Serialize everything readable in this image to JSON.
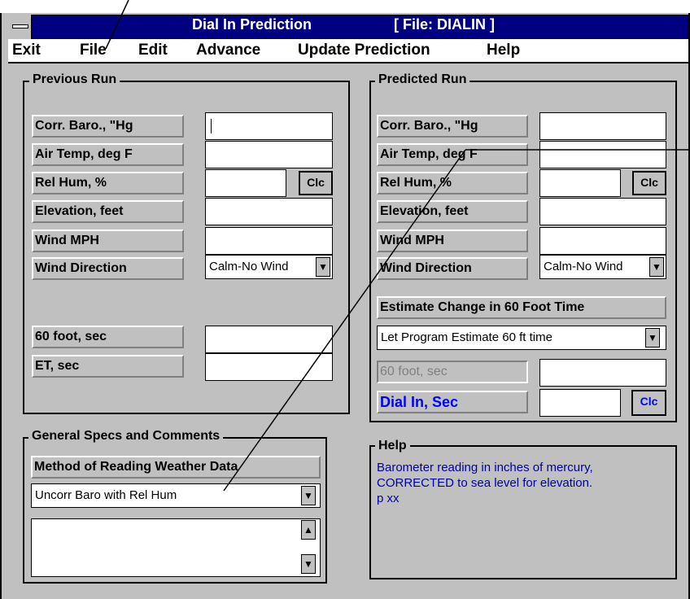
{
  "window": {
    "title": "Dial In Prediction",
    "file_label": "[ File: DIALIN ]"
  },
  "menu": [
    "Exit",
    "File",
    "Edit",
    "Advance",
    "Update Prediction",
    "Help"
  ],
  "previous_run": {
    "title": "Previous Run",
    "labels": [
      "Corr. Baro., \"Hg",
      "Air Temp, deg F",
      "Rel Hum, %",
      "Elevation, feet",
      "Wind MPH",
      "Wind Direction"
    ],
    "clc": "Clc",
    "wind_direction": "Calm-No Wind",
    "sixty_foot": "60 foot, sec",
    "et": "ET, sec"
  },
  "predicted_run": {
    "title": "Predicted Run",
    "labels": [
      "Corr. Baro., \"Hg",
      "Air Temp, deg F",
      "Rel Hum, %",
      "Elevation, feet",
      "Wind MPH",
      "Wind Direction"
    ],
    "clc": "Clc",
    "wind_direction": "Calm-No Wind",
    "estimate_label": "Estimate Change in 60 Foot Time",
    "estimate_value": "Let Program Estimate 60 ft time",
    "sixty_foot": "60 foot, sec",
    "dial_in": "Dial In, Sec",
    "dial_clc": "Clc"
  },
  "general": {
    "title": "General Specs and Comments",
    "method_label": "Method of Reading Weather Data",
    "method_value": "Uncorr Baro with Rel Hum"
  },
  "help": {
    "title": "Help",
    "lines": [
      "Barometer reading in inches of mercury,",
      "CORRECTED to sea level for elevation.",
      "p xx"
    ]
  },
  "icons": {
    "down": "▼",
    "up": "▲"
  }
}
